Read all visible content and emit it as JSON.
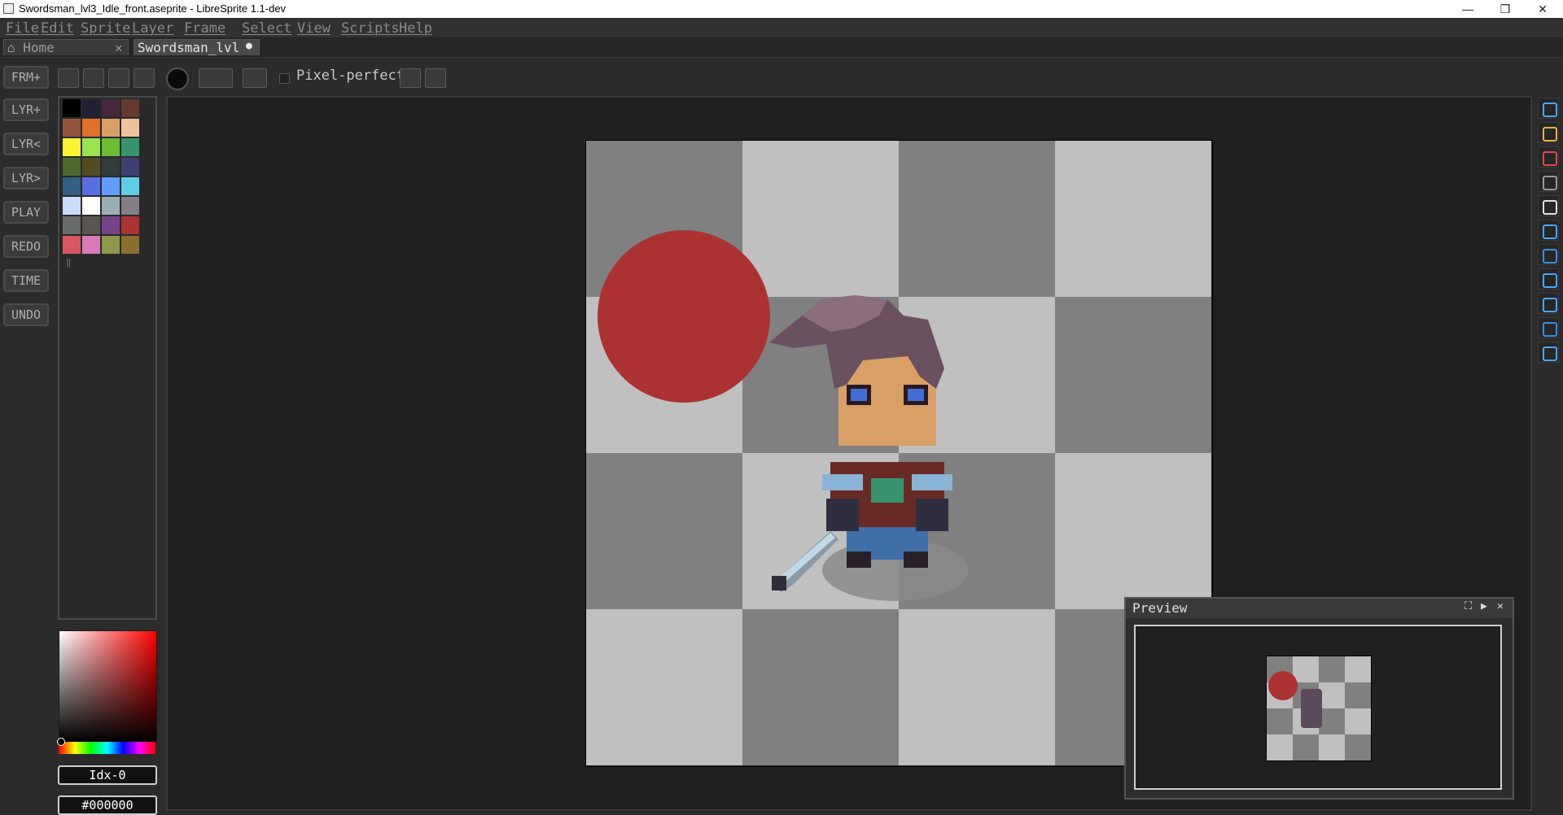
{
  "window": {
    "title": "Swordsman_lvl3_Idle_front.aseprite - LibreSprite 1.1-dev",
    "controls": [
      "—",
      "❐",
      "✕"
    ]
  },
  "menu": [
    "File",
    "Edit",
    "Sprite",
    "Layer",
    "Frame",
    "Select",
    "View",
    "Scripts",
    "Help"
  ],
  "tabs": {
    "home": {
      "label": "Home",
      "close": "✕"
    },
    "file": {
      "label": "Swordsman_lvl",
      "modified": "●"
    }
  },
  "context_bar": {
    "pixel_perfect_label": "Pixel-perfect",
    "pixel_perfect_checked": false
  },
  "left_buttons": [
    "FRM+",
    "LYR+",
    "LYR<",
    "LYR>",
    "PLAY",
    "REDO",
    "TIME",
    "UNDO"
  ],
  "palette": {
    "colors": [
      "#000000",
      "#222034",
      "#45283c",
      "#663931",
      "#8f563b",
      "#df7126",
      "#d9a066",
      "#eec39a",
      "#fbf236",
      "#99e550",
      "#6abe30",
      "#37946e",
      "#4b692f",
      "#524b24",
      "#323c39",
      "#3f3f74",
      "#306082",
      "#5b6ee1",
      "#639bff",
      "#5fcde4",
      "#cbdbfc",
      "#ffffff",
      "#9badb7",
      "#847e87",
      "#696a6a",
      "#595652",
      "#76428a",
      "#ac3232",
      "#d95763",
      "#d77bba",
      "#8f974a",
      "#8a6f30"
    ],
    "marker": "‖"
  },
  "color_fields": {
    "index": "Idx-0",
    "hex": "#000000"
  },
  "canvas": {
    "checker_dark": "#808080",
    "checker_light": "#c0c0c0",
    "layer_circle_color": "#ac3232"
  },
  "preview": {
    "title": "Preview",
    "buttons": [
      "⛶",
      "▶",
      "✕"
    ]
  },
  "tools": [
    "marquee-icon",
    "pencil-icon",
    "eraser-icon",
    "eyedropper-icon",
    "zoom-icon",
    "move-icon",
    "paint-bucket-icon",
    "line-icon",
    "rectangle-icon",
    "lasso-icon",
    "blur-icon"
  ]
}
